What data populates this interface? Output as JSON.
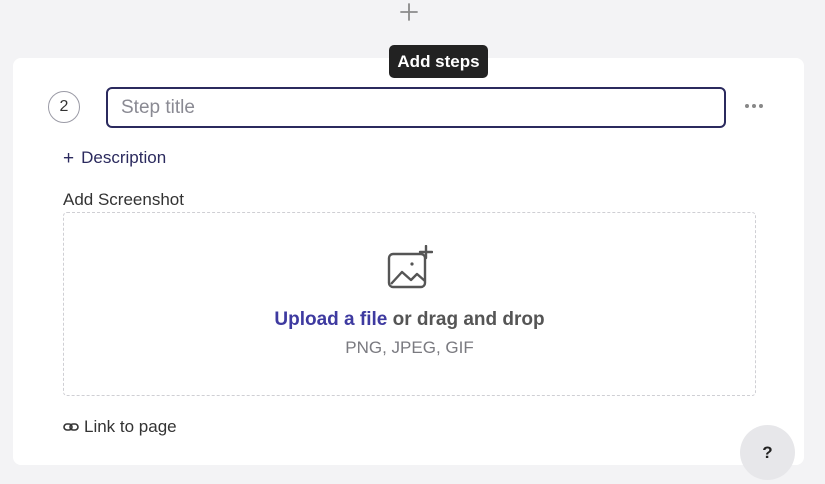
{
  "add_step": {
    "icon": "plus-icon",
    "tooltip": "Add steps"
  },
  "step": {
    "number": "2",
    "title_value": "",
    "title_placeholder": "Step title",
    "more_icon": "more-horizontal-icon"
  },
  "description": {
    "plus": "+",
    "label": "Description"
  },
  "screenshot": {
    "label": "Add Screenshot",
    "icon": "image-add-icon",
    "upload_link": "Upload a file",
    "drag_text": " or drag and drop",
    "formats": "PNG, JPEG, GIF"
  },
  "link_page": {
    "icon": "link-icon",
    "label": "Link to page"
  },
  "help": {
    "label": "?"
  },
  "colors": {
    "accent": "#3e3aa0",
    "input_border": "#2b2a5e",
    "tooltip_bg": "#222222",
    "background": "#f3f3f5"
  }
}
